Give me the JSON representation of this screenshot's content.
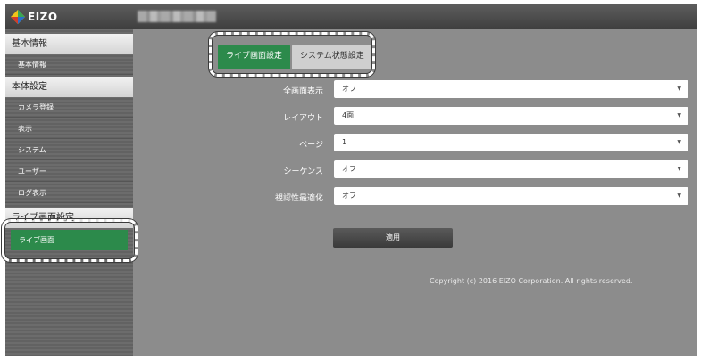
{
  "header": {
    "logo_text": "EIZO",
    "device_name_blurred": "",
    "logo_icon": "eizo-diamond-logo"
  },
  "sidebar": {
    "sections": [
      {
        "title": "基本情報",
        "items": [
          {
            "label": "基本情報",
            "active": false
          }
        ]
      },
      {
        "title": "本体設定",
        "items": [
          {
            "label": "カメラ登録",
            "active": false
          },
          {
            "label": "表示",
            "active": false
          },
          {
            "label": "システム",
            "active": false
          },
          {
            "label": "ユーザー",
            "active": false
          },
          {
            "label": "ログ表示",
            "active": false
          }
        ]
      },
      {
        "title": "ライブ画面設定",
        "items": [
          {
            "label": "ライブ画面",
            "active": true
          }
        ]
      }
    ]
  },
  "tabs": [
    {
      "label": "ライブ画面設定",
      "active": true
    },
    {
      "label": "システム状態設定",
      "active": false
    }
  ],
  "form": {
    "fields": [
      {
        "label": "全画面表示",
        "value": "オフ"
      },
      {
        "label": "レイアウト",
        "value": "4面"
      },
      {
        "label": "ページ",
        "value": "1"
      },
      {
        "label": "シーケンス",
        "value": "オフ"
      },
      {
        "label": "視認性最適化",
        "value": "オフ"
      }
    ],
    "apply_label": "適用"
  },
  "footer": {
    "copyright": "Copyright (c) 2016 EIZO Corporation. All rights reserved."
  },
  "colors": {
    "accent": "#2c8a4b",
    "background": "#8c8c8c",
    "header": "#4a4a4a"
  }
}
